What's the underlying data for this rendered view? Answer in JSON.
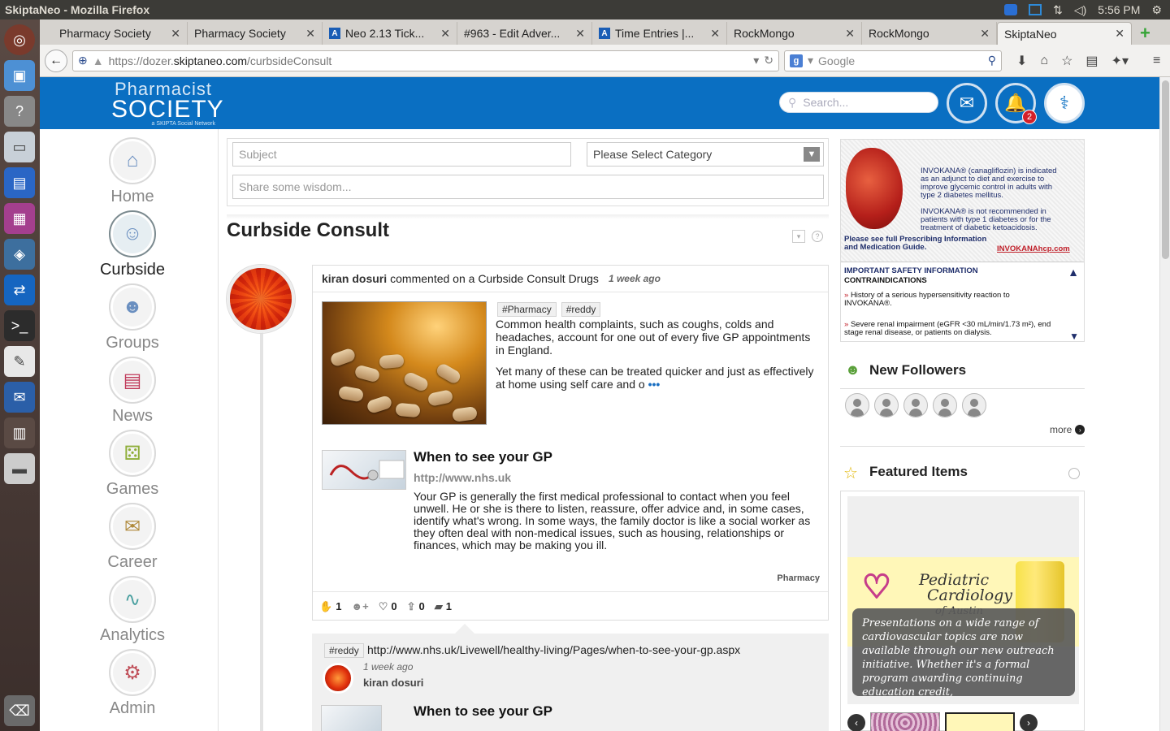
{
  "os": {
    "window_title": "SkiptaNeo - Mozilla Firefox",
    "clock": "5:56 PM"
  },
  "browser": {
    "tabs": [
      {
        "label": "Pharmacy Society",
        "favicon": ""
      },
      {
        "label": "Pharmacy Society",
        "favicon": ""
      },
      {
        "label": "Neo 2.13 Tick...",
        "favicon": "A"
      },
      {
        "label": "#963 - Edit Adver...",
        "favicon": ""
      },
      {
        "label": "Time Entries |...",
        "favicon": "A"
      },
      {
        "label": "RockMongo",
        "favicon": ""
      },
      {
        "label": "RockMongo",
        "favicon": ""
      },
      {
        "label": "SkiptaNeo",
        "favicon": ""
      }
    ],
    "tab_close": "✕",
    "url_prefix": "https://dozer.",
    "url_domain": "skiptaneo.com",
    "url_path": "/curbsideConsult",
    "search_engine_letter": "g",
    "search_placeholder": "Google"
  },
  "site": {
    "logo_line1": "Pharmacist",
    "logo_line2": "SOCIETY",
    "logo_tagline": "a SKIPTA Social Network",
    "search_placeholder": "Search...",
    "notification_count": "2"
  },
  "nav": {
    "items": [
      {
        "label": "Home",
        "icon": "⌂"
      },
      {
        "label": "Curbside",
        "icon": "☺"
      },
      {
        "label": "Groups",
        "icon": "☻"
      },
      {
        "label": "News",
        "icon": "▤"
      },
      {
        "label": "Games",
        "icon": "⚄"
      },
      {
        "label": "Career",
        "icon": "✉"
      },
      {
        "label": "Analytics",
        "icon": "∿"
      },
      {
        "label": "Admin",
        "icon": "⚙"
      }
    ]
  },
  "composer": {
    "subject_placeholder": "Subject",
    "category_placeholder": "Please Select Category",
    "body_placeholder": "Share some wisdom..."
  },
  "page": {
    "title": "Curbside Consult"
  },
  "post": {
    "author": "kiran dosuri",
    "action": "commented on a Curbside Consult Drugs",
    "time_ago": "1 week ago",
    "tags": [
      "#Pharmacy",
      "#reddy"
    ],
    "paragraph1": "Common health complaints, such as coughs, colds and headaches, account for one out of every five GP appointments in England.",
    "paragraph2": "Yet many of these can be treated quicker and just as effectively at home using self care and o",
    "more": "•••",
    "link_title": "When to see your GP",
    "link_url": "http://www.nhs.uk",
    "link_desc": "Your GP is generally the first medical professional to contact when you feel unwell. He or she is there to listen, reassure, offer advice and, in some cases, identify what's wrong. In some ways, the family doctor is like a social worker as they often deal with non-medical issues, such as housing, relationships or finances, which may be making you ill.",
    "category": "Pharmacy",
    "counts": {
      "agree": "1",
      "likes": "0",
      "shares": "0",
      "comments": "1"
    }
  },
  "comment": {
    "tag": "#reddy",
    "url": "http://www.nhs.uk/Livewell/healthy-living/Pages/when-to-see-your-gp.aspx",
    "time_ago": "1 week ago",
    "author": "kiran dosuri",
    "link_title": "When to see your GP"
  },
  "ad": {
    "para1": "INVOKANA® (canagliflozin) is indicated as an adjunct to diet and exercise to improve glycemic control in adults with type 2 diabetes mellitus.",
    "para2": "INVOKANA® is not recommended in patients with type 1 diabetes or for the treatment of diabetic ketoacidosis.",
    "links_line1": "Please see full Prescribing Information",
    "links_line2": "and Medication Guide.",
    "site": "INVOKANAhcp.com",
    "isi_title": "IMPORTANT SAFETY INFORMATION",
    "isi_sub": "CONTRAINDICATIONS",
    "isi_item1": "History of a serious hypersensitivity reaction to INVOKANA®.",
    "isi_item2": "Severe renal impairment (eGFR <30 mL/min/1.73 m²), end stage renal disease, or patients on dialysis."
  },
  "followers": {
    "title": "New Followers",
    "more": "more"
  },
  "featured": {
    "title": "Featured Items",
    "logo_line1": "Pediatric",
    "logo_line2": "Cardiology",
    "logo_line3": "of Austin",
    "caption": "Presentations on a wide range of cardiovascular topics are now available through our new outreach initiative. Whether it's a formal program awarding continuing education credit,"
  },
  "colors": {
    "brand_blue": "#0a6fc2",
    "link_blue": "#1a6fc2"
  }
}
